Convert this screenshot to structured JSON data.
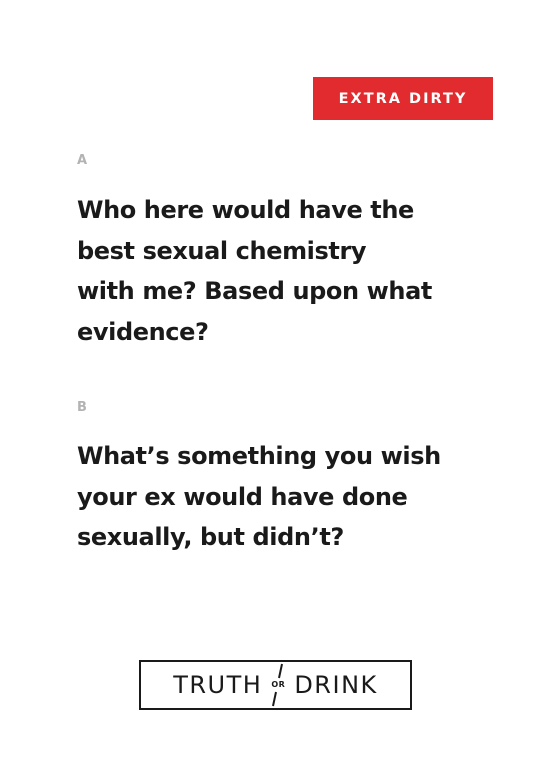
{
  "badge": {
    "text": "EXTRA DIRTY",
    "color": "#e12b2e"
  },
  "questions": [
    {
      "label": "A",
      "lines": [
        "Who here would have the",
        "best sexual chemistry",
        "with me? Based upon what",
        "evidence?"
      ]
    },
    {
      "label": "B",
      "lines": [
        "What’s something you wish",
        "your ex would have done",
        "sexually, but didn’t?"
      ]
    }
  ],
  "logo": {
    "left": "TRUTH",
    "middle": "OR",
    "right": "DRINK"
  }
}
